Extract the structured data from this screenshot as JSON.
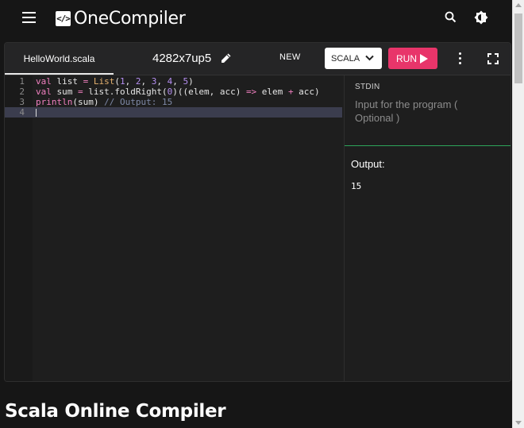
{
  "header": {
    "logo_glyph": "</>",
    "logo_text": "OneCompiler"
  },
  "toolbar": {
    "file_tab": "HelloWorld.scala",
    "project_id": "4282x7up5",
    "new_label": "NEW",
    "language": "SCALA",
    "run_label": "RUN"
  },
  "editor": {
    "line_numbers": [
      "1",
      "2",
      "3",
      "4"
    ],
    "current_line": 4
  },
  "stdin": {
    "label": "STDIN",
    "placeholder": "Input for the program ( Optional )",
    "value": ""
  },
  "output": {
    "label": "Output:",
    "value": "15"
  },
  "page": {
    "heading": "Scala Online Compiler"
  },
  "colors": {
    "run_button": "#e8356a",
    "stdin_divider": "#2ea55a",
    "current_line_highlight": "#3b3d4e",
    "keyword": "#f07fbf",
    "type": "#e3b06e",
    "number": "#b48ef0",
    "comment": "#7f8aa8"
  }
}
